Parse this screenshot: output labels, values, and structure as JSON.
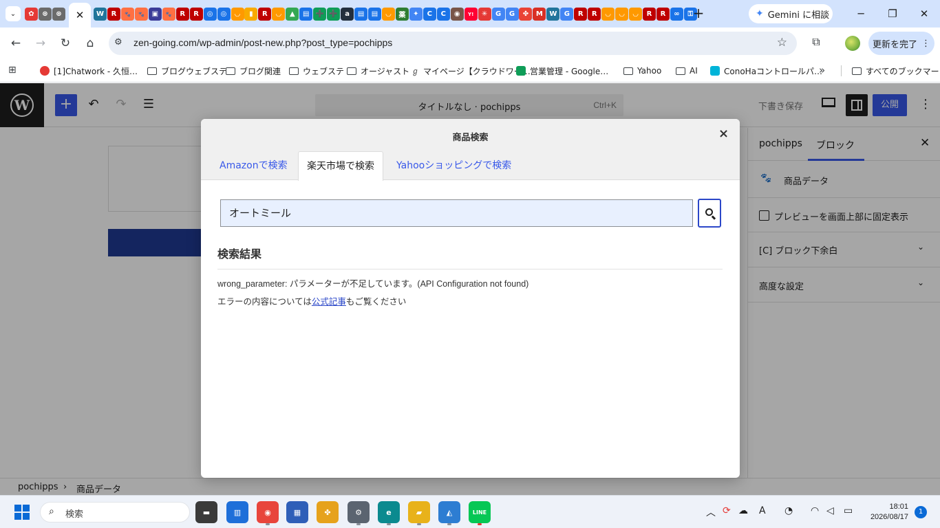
{
  "browser": {
    "tab_icons": [
      {
        "name": "chatwork-tab-icon",
        "glyph": "✿",
        "color": "#e53935"
      },
      {
        "name": "chatgpt-tab-icon",
        "glyph": "⊛",
        "color": "#6b6b6b"
      },
      {
        "name": "chatgpt-tab-icon-2",
        "glyph": "⊛",
        "color": "#6b6b6b"
      },
      {
        "name": "wordpress-tab-icon",
        "glyph": "W",
        "color": "#21759b"
      },
      {
        "name": "rakuten-tab-icon",
        "glyph": "R",
        "color": "#bf0000"
      },
      {
        "name": "paw-tab-icon",
        "glyph": "🐾",
        "color": "#ff7043"
      },
      {
        "name": "paw-tab-icon-2",
        "glyph": "🐾",
        "color": "#ff7043"
      },
      {
        "name": "ad-tab-icon",
        "glyph": "▣",
        "color": "#3b3b98"
      },
      {
        "name": "paw-tab-icon-3",
        "glyph": "🐾",
        "color": "#ff7043"
      },
      {
        "name": "rakuten-tab-icon-2",
        "glyph": "R",
        "color": "#bf0000"
      },
      {
        "name": "rakuten-tab-icon-3",
        "glyph": "R",
        "color": "#bf0000"
      },
      {
        "name": "lens-tab-icon",
        "glyph": "◎",
        "color": "#1a73e8"
      },
      {
        "name": "lens-tab-icon-2",
        "glyph": "◎",
        "color": "#1a73e8"
      },
      {
        "name": "amazon-tab-icon",
        "glyph": "◡",
        "color": "#ff9900"
      },
      {
        "name": "analytics-tab-icon",
        "glyph": "▮",
        "color": "#f9ab00"
      },
      {
        "name": "rakuten-tab-icon-4",
        "glyph": "R",
        "color": "#bf0000"
      },
      {
        "name": "amazon-tab-icon-2",
        "glyph": "◡",
        "color": "#ff9900"
      },
      {
        "name": "drive-tab-icon",
        "glyph": "▲",
        "color": "#34a853"
      },
      {
        "name": "docs-tab-icon",
        "glyph": "▤",
        "color": "#1a73e8"
      },
      {
        "name": "sheets-tab-icon",
        "glyph": "➕",
        "color": "#0f9d58"
      },
      {
        "name": "sheets-tab-icon-2",
        "glyph": "➕",
        "color": "#0f9d58"
      },
      {
        "name": "amazon-a-tab-icon",
        "glyph": "a",
        "color": "#232f3e"
      },
      {
        "name": "docs-tab-icon-2",
        "glyph": "▤",
        "color": "#1a73e8"
      },
      {
        "name": "docs-tab-icon-3",
        "glyph": "▤",
        "color": "#1a73e8"
      },
      {
        "name": "amazon-tab-icon-3",
        "glyph": "◡",
        "color": "#ff9900"
      },
      {
        "name": "rakuten-pharmacy-tab-icon",
        "glyph": "薬",
        "color": "#2e7d32"
      },
      {
        "name": "gemini-tab-icon",
        "glyph": "✦",
        "color": "#4285f4"
      },
      {
        "name": "c-tab-icon",
        "glyph": "C",
        "color": "#1a73e8"
      },
      {
        "name": "c-tab-icon-2",
        "glyph": "C",
        "color": "#1a73e8"
      },
      {
        "name": "owl-tab-icon",
        "glyph": "◉",
        "color": "#795548"
      },
      {
        "name": "yahoo-tab-icon",
        "glyph": "Y!",
        "color": "#ff0033"
      },
      {
        "name": "asterisk-tab-icon",
        "glyph": "✳",
        "color": "#e53935"
      },
      {
        "name": "google-tab-icon",
        "glyph": "G",
        "color": "#4285f4"
      },
      {
        "name": "google-tab-icon-2",
        "glyph": "G",
        "color": "#4285f4"
      },
      {
        "name": "photos-tab-icon",
        "glyph": "✤",
        "color": "#ea4335"
      },
      {
        "name": "gmail-tab-icon",
        "glyph": "M",
        "color": "#d93025"
      },
      {
        "name": "wordpress-tab-icon-2",
        "glyph": "W",
        "color": "#21759b"
      },
      {
        "name": "google-tab-icon-3",
        "glyph": "G",
        "color": "#4285f4"
      },
      {
        "name": "rakuten-tab-icon-5",
        "glyph": "R",
        "color": "#bf0000"
      },
      {
        "name": "rakuten-tab-icon-6",
        "glyph": "R",
        "color": "#bf0000"
      },
      {
        "name": "amazon-tab-icon-4",
        "glyph": "◡",
        "color": "#ff9900"
      },
      {
        "name": "amazon-tab-icon-5",
        "glyph": "◡",
        "color": "#ff9900"
      },
      {
        "name": "amazon-tab-icon-6",
        "glyph": "◡",
        "color": "#ff9900"
      },
      {
        "name": "rakuten-tab-icon-7",
        "glyph": "R",
        "color": "#bf0000"
      },
      {
        "name": "rakuten-tab-icon-8",
        "glyph": "R",
        "color": "#bf0000"
      },
      {
        "name": "link-tab-icon",
        "glyph": "∞",
        "color": "#1a73e8"
      },
      {
        "name": "key-tab-icon",
        "glyph": "⚿",
        "color": "#1a73e8"
      }
    ],
    "active_tab_close": "✕",
    "new_tab": "+",
    "gemini_button": "Gemini に相談",
    "window_controls": {
      "minimize": "─",
      "maximize": "❐",
      "close": "✕"
    },
    "address": {
      "url": "zen-going.com/wp-admin/post-new.php?post_type=pochipps",
      "bookmark_star": "☆"
    },
    "update_button": "更新を完了",
    "bookmarks": [
      {
        "label": "[1]Chatwork - 久恒…",
        "kind": "favicon",
        "color": "#e53935"
      },
      {
        "label": "ブログウェブステ",
        "kind": "folder"
      },
      {
        "label": "ブログ関連",
        "kind": "folder"
      },
      {
        "label": "ウェブステ",
        "kind": "folder"
      },
      {
        "label": "オージャスト",
        "kind": "folder"
      },
      {
        "label": "マイページ【クラウドワー…",
        "kind": "favicon",
        "color": "#444444"
      },
      {
        "label": "営業管理 - Google…",
        "kind": "favicon",
        "color": "#0f9d58"
      },
      {
        "label": "Yahoo",
        "kind": "folder"
      },
      {
        "label": "AI",
        "kind": "folder"
      },
      {
        "label": "ConoHaコントロールパ…",
        "kind": "favicon",
        "color": "#00b4d8"
      }
    ],
    "bookmarks_overflow": "»",
    "all_bookmarks": "すべてのブックマーク"
  },
  "wp": {
    "logo": "W",
    "add_block": "+",
    "undo": "↶",
    "redo": "↷",
    "list_view": "☰",
    "document_title": "タイトルなし · pochipps",
    "document_shortcut": "Ctrl+K",
    "save_draft": "下書き保存",
    "publish": "公開",
    "more": "⋮",
    "sidebar": {
      "tabs": [
        "pochipps",
        "ブロック"
      ],
      "close": "✕",
      "block_name": "商品データ",
      "block_icon": "🐾",
      "checkbox_label": "プレビューを画面上部に固定表示",
      "panels": [
        "[C] ブロック下余白",
        "高度な設定"
      ],
      "chevron": "⌄"
    },
    "breadcrumb": [
      "pochipps",
      "商品データ"
    ],
    "breadcrumb_separator": "›"
  },
  "modal": {
    "title": "商品検索",
    "close": "×",
    "tabs": [
      "Amazonで検索",
      "楽天市場で検索",
      "Yahooショッピングで検索"
    ],
    "active_tab": "楽天市場で検索",
    "search_value": "オートミール",
    "results_heading": "検索結果",
    "error_line": "wrong_parameter: パラメーターが不足しています。(API Configuration not found)",
    "help_prefix": "エラーの内容については",
    "help_link": "公式記事",
    "help_suffix": "もご覧ください"
  },
  "taskbar": {
    "search_placeholder": "検索",
    "apps": [
      {
        "name": "file-explorer-taskbar-icon",
        "glyph": "▬",
        "color": "#3a3a3a"
      },
      {
        "name": "widgets-taskbar-icon",
        "glyph": "▥",
        "color": "#1e6fd9"
      },
      {
        "name": "chrome-taskbar-icon",
        "glyph": "◉",
        "color": "#e8453c"
      },
      {
        "name": "store-taskbar-icon",
        "glyph": "▦",
        "color": "#2f5fb8"
      },
      {
        "name": "photos-taskbar-icon",
        "glyph": "✤",
        "color": "#e6a21c"
      },
      {
        "name": "settings-taskbar-icon",
        "glyph": "⚙",
        "color": "#5b6470"
      },
      {
        "name": "edge-taskbar-icon",
        "glyph": "e",
        "color": "#0b8a8f"
      },
      {
        "name": "folder-taskbar-icon",
        "glyph": "▰",
        "color": "#e8b21a"
      },
      {
        "name": "paint-taskbar-icon",
        "glyph": "◭",
        "color": "#2d7dd2"
      },
      {
        "name": "line-taskbar-icon",
        "glyph": "LINE",
        "color": "#06c755"
      }
    ],
    "tray": {
      "chevron": "︿",
      "language": "A",
      "time": "18:01",
      "date": "2026/08/17",
      "notification_count": "1"
    }
  }
}
